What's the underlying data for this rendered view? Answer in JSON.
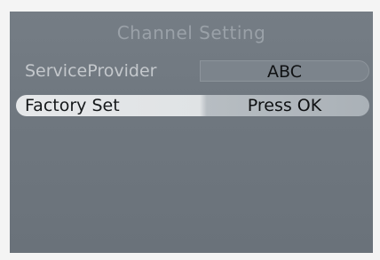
{
  "menu": {
    "title": "Channel Setting",
    "items": [
      {
        "label": "ServiceProvider",
        "value": "ABC",
        "selected": false
      },
      {
        "label": "Factory Set",
        "value": "Press OK",
        "selected": true
      }
    ]
  },
  "colors": {
    "screen_bg": "#737b83",
    "title_text": "#9aa1a8",
    "label_text": "#c4c8cc",
    "highlight_bg": "#e3e5e7",
    "value_text": "#101214"
  }
}
